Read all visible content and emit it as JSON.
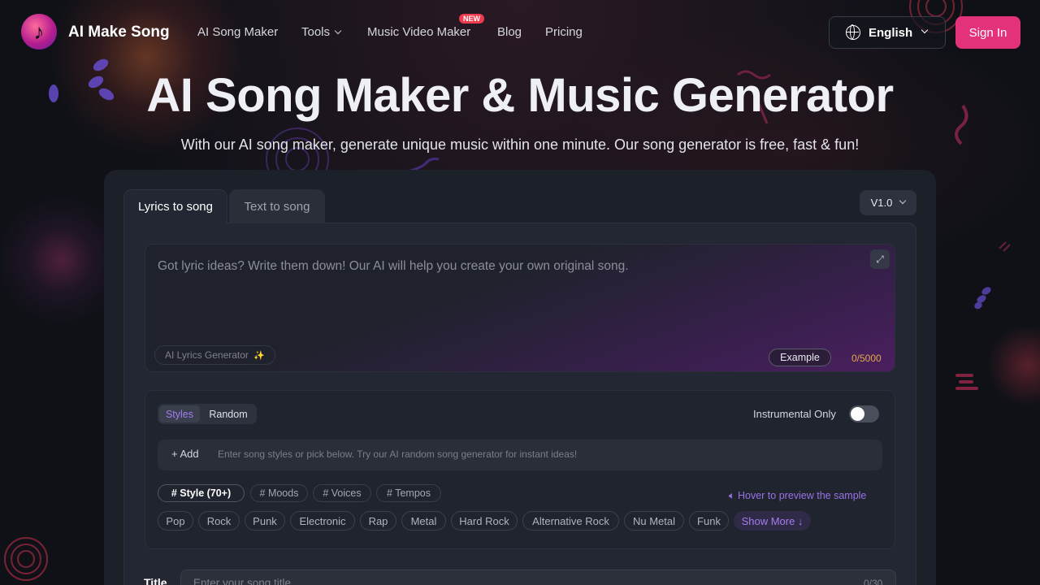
{
  "nav": {
    "brand": "AI Make Song",
    "links": {
      "song_maker": "AI Song Maker",
      "tools": "Tools",
      "music_video": "Music Video Maker",
      "blog": "Blog",
      "pricing": "Pricing"
    },
    "new_badge": "NEW",
    "language": "English",
    "sign_in": "Sign In"
  },
  "hero": {
    "title": "AI Song Maker & Music Generator",
    "subtitle": "With our AI song maker, generate unique music within one minute. Our song generator is free, fast & fun!"
  },
  "tabs": {
    "lyrics": "Lyrics to song",
    "text": "Text to song",
    "version": "V1.0"
  },
  "lyrics": {
    "placeholder": "Got lyric ideas? Write them down! Our AI will help you create your own original song.",
    "ai_generator": "AI Lyrics Generator",
    "example": "Example",
    "counter": "0/5000"
  },
  "styles": {
    "seg_styles": "Styles",
    "seg_random": "Random",
    "instrumental": "Instrumental Only",
    "instrumental_on": false,
    "add": "+ Add",
    "input_placeholder": "Enter song styles or pick below. Try our AI random song generator for instant ideas!",
    "categories": [
      "# Style  (70+)",
      "# Moods",
      "# Voices",
      "# Tempos"
    ],
    "hover_hint": "Hover to preview the sample",
    "chips": [
      "Pop",
      "Rock",
      "Punk",
      "Electronic",
      "Rap",
      "Metal",
      "Hard Rock",
      "Alternative Rock",
      "Nu Metal",
      "Funk"
    ],
    "show_more": "Show More ↓"
  },
  "title_field": {
    "label": "Title",
    "placeholder": "Enter your song title",
    "counter": "0/30"
  },
  "colors": {
    "accent_pink": "#e3327a",
    "accent_purple": "#a57cf0",
    "counter_orange": "#e2a94a",
    "badge_red": "#ef3b4e"
  }
}
